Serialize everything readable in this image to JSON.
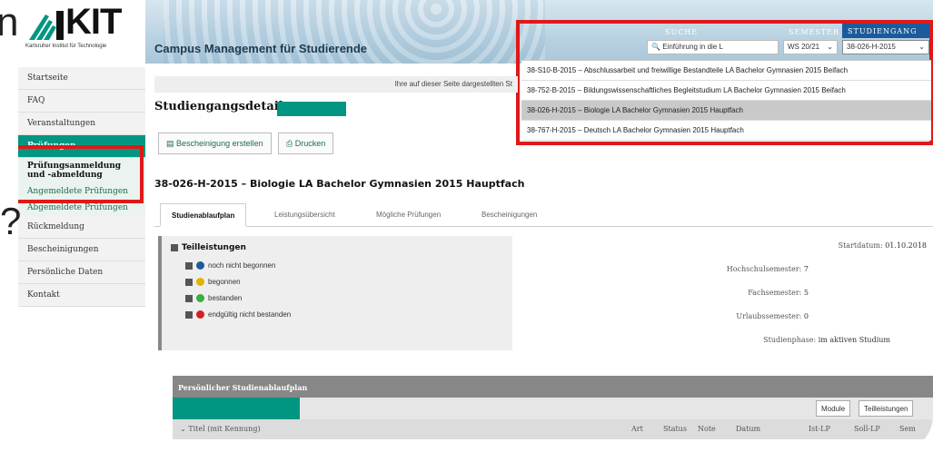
{
  "header": {
    "logo_text": "KIT",
    "logo_sub": "Karlsruher Institut für Technologie",
    "app_title": "Campus Management für Studierende"
  },
  "filters": {
    "search_label": "SUCHE",
    "search_value": "Einführung in die L",
    "semester_label": "SEMESTER",
    "semester_value": "WS 20/21",
    "studiengang_label": "STUDIENGANG",
    "studiengang_value": "38-026-H-2015",
    "options": [
      "38-S10-B-2015 – Abschlussarbeit und freiwillige Bestandteile LA Bachelor Gymnasien 2015 Beifach",
      "38-752-B-2015 – Bildungswissenschaftliches Begleitstudium LA Bachelor Gymnasien 2015 Beifach",
      "38-026-H-2015 – Biologie LA Bachelor Gymnasien 2015 Hauptfach",
      "38-767-H-2015 – Deutsch LA Bachelor Gymnasien 2015 Hauptfach"
    ]
  },
  "sidebar": {
    "items": [
      "Startseite",
      "FAQ",
      "Veranstaltungen",
      "Prüfungen"
    ],
    "sub_items": [
      "Prüfungsanmeldung und -abmeldung",
      "Angemeldete Prüfungen",
      "Abgemeldete Prüfungen"
    ],
    "items2": [
      "Rückmeldung",
      "Bescheinigungen",
      "Persönliche Daten",
      "Kontakt"
    ]
  },
  "content": {
    "info_text": "Ihre auf dieser Seite dargestellten St",
    "page_title": "Studiengangsdetails",
    "btn_cert": "Bescheinigung erstellen",
    "btn_print": "Drucken",
    "study_title": "38-026-H-2015 – Biologie LA Bachelor Gymnasien 2015 Hauptfach",
    "tabs": [
      "Studienablaufplan",
      "Leistungsübersicht",
      "Mögliche Prüfungen",
      "Bescheinigungen"
    ],
    "legend_title": "Teilleistungen",
    "legend": [
      "noch nicht begonnen",
      "begonnen",
      "bestanden",
      "endgültig nicht bestanden"
    ],
    "details": [
      {
        "label": "Startdatum:",
        "value": "01.10.2018"
      },
      {
        "label": "Hochschulsemester:",
        "value": "7"
      },
      {
        "label": "Fachsemester:",
        "value": "5"
      },
      {
        "label": "Urlaubssemester:",
        "value": "0"
      },
      {
        "label": "Studienphase:",
        "value": "im aktiven Studium"
      }
    ],
    "plan_header": "Persönlicher Studienablaufplan",
    "btn_module": "Module",
    "btn_teil": "Teilleistungen",
    "cols": [
      "Titel (mit Kennung)",
      "Art",
      "Status",
      "Note",
      "Datum",
      "Ist-LP",
      "Soll-LP",
      "Sem"
    ]
  },
  "colors": {
    "accent": "#009682",
    "highlight": "#e01818",
    "blue": "#1c5b9b"
  }
}
